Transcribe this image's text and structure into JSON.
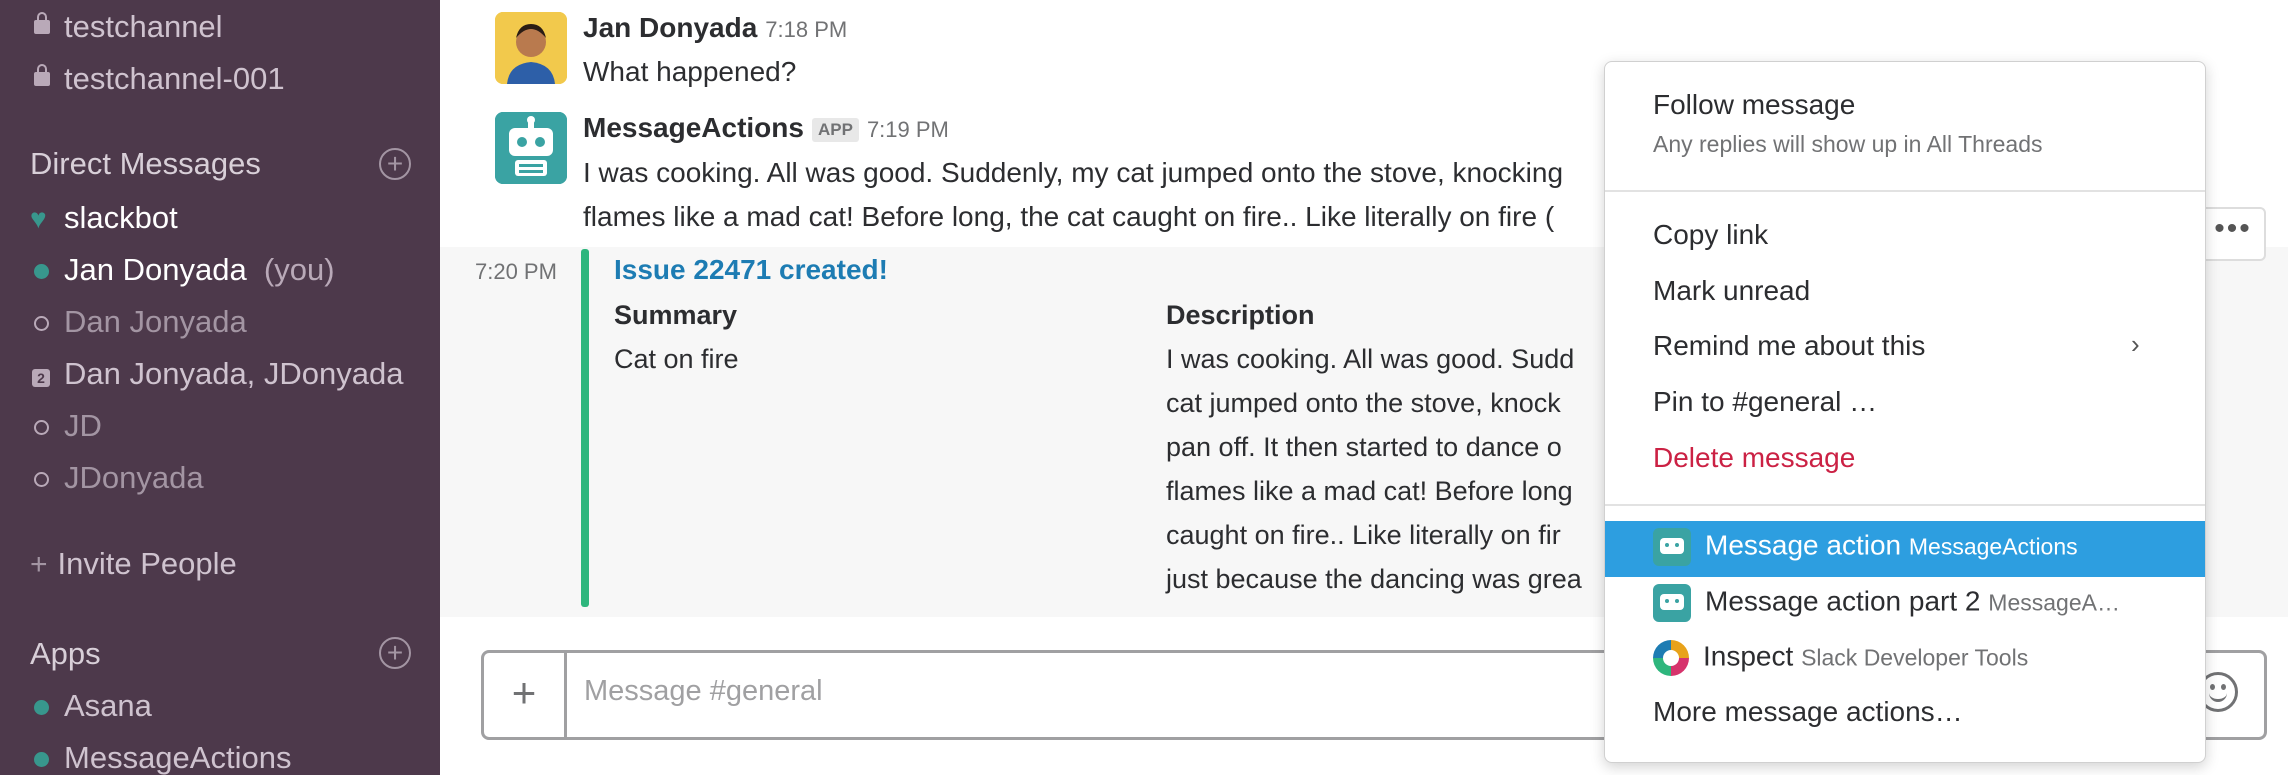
{
  "sidebar": {
    "channels": [
      {
        "name": "testchannel"
      },
      {
        "name": "testchannel-001"
      }
    ],
    "dm_heading": "Direct Messages",
    "dms": [
      {
        "name": "slackbot",
        "status": "heart"
      },
      {
        "name": "Jan Donyada",
        "suffix": "(you)",
        "status": "online"
      },
      {
        "name": "Dan Jonyada",
        "status": "away"
      },
      {
        "name": "Dan Jonyada, JDonyada",
        "status": "group",
        "badge": "2"
      },
      {
        "name": "JD",
        "status": "away"
      },
      {
        "name": "JDonyada",
        "status": "away"
      }
    ],
    "invite_label": "Invite People",
    "apps_heading": "Apps",
    "apps": [
      {
        "name": "Asana",
        "status": "online"
      },
      {
        "name": "MessageActions",
        "status": "online"
      }
    ]
  },
  "messages": [
    {
      "author": "Jan Donyada",
      "time": "7:18 PM",
      "text": "What happened?"
    },
    {
      "author": "MessageActions",
      "badge": "APP",
      "time": "7:19 PM",
      "line1": "I was cooking. All was good. Suddenly, my cat jumped onto the stove, knocking",
      "line2": "flames like a mad cat! Before long, the cat caught on fire.. Like literally on fire ("
    }
  ],
  "attachment": {
    "time": "7:20 PM",
    "title": "Issue 22471 created!",
    "summary_label": "Summary",
    "summary_value": "Cat on fire",
    "description_label": "Description",
    "description_lines": [
      "I was cooking. All was good. Sudd",
      "cat jumped onto the stove, knock",
      "pan off. It then started to dance o",
      "flames like a mad cat! Before long",
      "caught on fire.. Like literally on fir",
      "just because the dancing was grea"
    ]
  },
  "more_button": "•••",
  "composer": {
    "placeholder": "Message #general",
    "plus": "+"
  },
  "menu": {
    "follow": "Follow message",
    "follow_sub": "Any replies will show up in All Threads",
    "copy_link": "Copy link",
    "mark_unread": "Mark unread",
    "remind": "Remind me about this",
    "pin": "Pin to #general …",
    "delete": "Delete message",
    "actions": [
      {
        "label": "Message action",
        "app": "MessageActions",
        "icon": "bot-icon",
        "highlighted": true
      },
      {
        "label": "Message action part 2",
        "app": "MessageA…",
        "icon": "bot-icon"
      },
      {
        "label": "Inspect",
        "app": "Slack Developer Tools",
        "icon": "gear-icon"
      }
    ],
    "more_actions": "More message actions…"
  },
  "colors": {
    "sidebar": "#4d394b",
    "highlight": "#2d9ee0",
    "danger": "#cb2144",
    "link": "#1d7cb3",
    "attachment_bar": "#2eb67d"
  }
}
